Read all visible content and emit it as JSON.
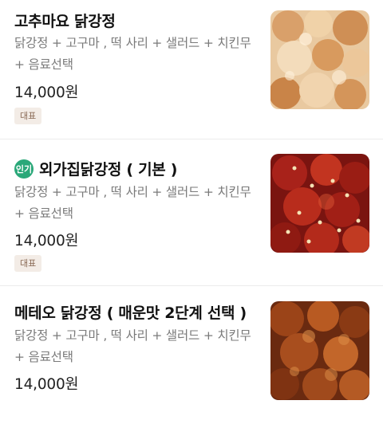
{
  "menu": {
    "items": [
      {
        "name": "고추마요 닭강정",
        "description": "닭강정 + 고구마 , 떡 사리 + 샐러드 + 치킨무 + 음료선택",
        "price": "14,000원",
        "badge": "대표",
        "image": "spicy-mayo-chicken-photo"
      },
      {
        "popular_badge": "인기",
        "name": "외가집닭강정 ( 기본 )",
        "description": "닭강정 + 고구마 , 떡 사리 + 샐러드 + 치킨무 + 음료선택",
        "price": "14,000원",
        "badge": "대표",
        "image": "sweet-chili-chicken-photo"
      },
      {
        "name": "메테오 닭강정 ( 매운맛 2단계 선택 )",
        "description": "닭강정 + 고구마 , 떡 사리 + 샐러드 + 치킨무 + 음료선택",
        "price": "14,000원",
        "image": "spicy-glazed-chicken-photo"
      }
    ]
  },
  "colors": {
    "popular_badge": "#2aa879",
    "tag_background": "#f3ece6",
    "tag_text": "#8a6a55",
    "description_text": "#7a7a7a"
  }
}
